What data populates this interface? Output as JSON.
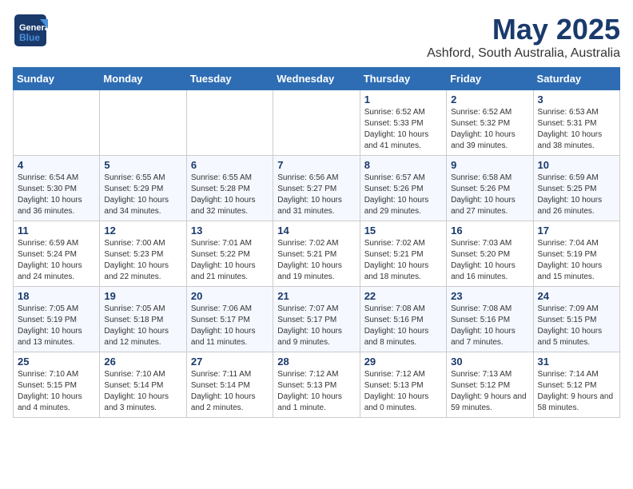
{
  "header": {
    "logo_line1": "General",
    "logo_line2": "Blue",
    "month": "May 2025",
    "location": "Ashford, South Australia, Australia"
  },
  "weekdays": [
    "Sunday",
    "Monday",
    "Tuesday",
    "Wednesday",
    "Thursday",
    "Friday",
    "Saturday"
  ],
  "weeks": [
    [
      {
        "day": "",
        "sunrise": "",
        "sunset": "",
        "daylight": ""
      },
      {
        "day": "",
        "sunrise": "",
        "sunset": "",
        "daylight": ""
      },
      {
        "day": "",
        "sunrise": "",
        "sunset": "",
        "daylight": ""
      },
      {
        "day": "",
        "sunrise": "",
        "sunset": "",
        "daylight": ""
      },
      {
        "day": "1",
        "sunrise": "Sunrise: 6:52 AM",
        "sunset": "Sunset: 5:33 PM",
        "daylight": "Daylight: 10 hours and 41 minutes."
      },
      {
        "day": "2",
        "sunrise": "Sunrise: 6:52 AM",
        "sunset": "Sunset: 5:32 PM",
        "daylight": "Daylight: 10 hours and 39 minutes."
      },
      {
        "day": "3",
        "sunrise": "Sunrise: 6:53 AM",
        "sunset": "Sunset: 5:31 PM",
        "daylight": "Daylight: 10 hours and 38 minutes."
      }
    ],
    [
      {
        "day": "4",
        "sunrise": "Sunrise: 6:54 AM",
        "sunset": "Sunset: 5:30 PM",
        "daylight": "Daylight: 10 hours and 36 minutes."
      },
      {
        "day": "5",
        "sunrise": "Sunrise: 6:55 AM",
        "sunset": "Sunset: 5:29 PM",
        "daylight": "Daylight: 10 hours and 34 minutes."
      },
      {
        "day": "6",
        "sunrise": "Sunrise: 6:55 AM",
        "sunset": "Sunset: 5:28 PM",
        "daylight": "Daylight: 10 hours and 32 minutes."
      },
      {
        "day": "7",
        "sunrise": "Sunrise: 6:56 AM",
        "sunset": "Sunset: 5:27 PM",
        "daylight": "Daylight: 10 hours and 31 minutes."
      },
      {
        "day": "8",
        "sunrise": "Sunrise: 6:57 AM",
        "sunset": "Sunset: 5:26 PM",
        "daylight": "Daylight: 10 hours and 29 minutes."
      },
      {
        "day": "9",
        "sunrise": "Sunrise: 6:58 AM",
        "sunset": "Sunset: 5:26 PM",
        "daylight": "Daylight: 10 hours and 27 minutes."
      },
      {
        "day": "10",
        "sunrise": "Sunrise: 6:59 AM",
        "sunset": "Sunset: 5:25 PM",
        "daylight": "Daylight: 10 hours and 26 minutes."
      }
    ],
    [
      {
        "day": "11",
        "sunrise": "Sunrise: 6:59 AM",
        "sunset": "Sunset: 5:24 PM",
        "daylight": "Daylight: 10 hours and 24 minutes."
      },
      {
        "day": "12",
        "sunrise": "Sunrise: 7:00 AM",
        "sunset": "Sunset: 5:23 PM",
        "daylight": "Daylight: 10 hours and 22 minutes."
      },
      {
        "day": "13",
        "sunrise": "Sunrise: 7:01 AM",
        "sunset": "Sunset: 5:22 PM",
        "daylight": "Daylight: 10 hours and 21 minutes."
      },
      {
        "day": "14",
        "sunrise": "Sunrise: 7:02 AM",
        "sunset": "Sunset: 5:21 PM",
        "daylight": "Daylight: 10 hours and 19 minutes."
      },
      {
        "day": "15",
        "sunrise": "Sunrise: 7:02 AM",
        "sunset": "Sunset: 5:21 PM",
        "daylight": "Daylight: 10 hours and 18 minutes."
      },
      {
        "day": "16",
        "sunrise": "Sunrise: 7:03 AM",
        "sunset": "Sunset: 5:20 PM",
        "daylight": "Daylight: 10 hours and 16 minutes."
      },
      {
        "day": "17",
        "sunrise": "Sunrise: 7:04 AM",
        "sunset": "Sunset: 5:19 PM",
        "daylight": "Daylight: 10 hours and 15 minutes."
      }
    ],
    [
      {
        "day": "18",
        "sunrise": "Sunrise: 7:05 AM",
        "sunset": "Sunset: 5:19 PM",
        "daylight": "Daylight: 10 hours and 13 minutes."
      },
      {
        "day": "19",
        "sunrise": "Sunrise: 7:05 AM",
        "sunset": "Sunset: 5:18 PM",
        "daylight": "Daylight: 10 hours and 12 minutes."
      },
      {
        "day": "20",
        "sunrise": "Sunrise: 7:06 AM",
        "sunset": "Sunset: 5:17 PM",
        "daylight": "Daylight: 10 hours and 11 minutes."
      },
      {
        "day": "21",
        "sunrise": "Sunrise: 7:07 AM",
        "sunset": "Sunset: 5:17 PM",
        "daylight": "Daylight: 10 hours and 9 minutes."
      },
      {
        "day": "22",
        "sunrise": "Sunrise: 7:08 AM",
        "sunset": "Sunset: 5:16 PM",
        "daylight": "Daylight: 10 hours and 8 minutes."
      },
      {
        "day": "23",
        "sunrise": "Sunrise: 7:08 AM",
        "sunset": "Sunset: 5:16 PM",
        "daylight": "Daylight: 10 hours and 7 minutes."
      },
      {
        "day": "24",
        "sunrise": "Sunrise: 7:09 AM",
        "sunset": "Sunset: 5:15 PM",
        "daylight": "Daylight: 10 hours and 5 minutes."
      }
    ],
    [
      {
        "day": "25",
        "sunrise": "Sunrise: 7:10 AM",
        "sunset": "Sunset: 5:15 PM",
        "daylight": "Daylight: 10 hours and 4 minutes."
      },
      {
        "day": "26",
        "sunrise": "Sunrise: 7:10 AM",
        "sunset": "Sunset: 5:14 PM",
        "daylight": "Daylight: 10 hours and 3 minutes."
      },
      {
        "day": "27",
        "sunrise": "Sunrise: 7:11 AM",
        "sunset": "Sunset: 5:14 PM",
        "daylight": "Daylight: 10 hours and 2 minutes."
      },
      {
        "day": "28",
        "sunrise": "Sunrise: 7:12 AM",
        "sunset": "Sunset: 5:13 PM",
        "daylight": "Daylight: 10 hours and 1 minute."
      },
      {
        "day": "29",
        "sunrise": "Sunrise: 7:12 AM",
        "sunset": "Sunset: 5:13 PM",
        "daylight": "Daylight: 10 hours and 0 minutes."
      },
      {
        "day": "30",
        "sunrise": "Sunrise: 7:13 AM",
        "sunset": "Sunset: 5:12 PM",
        "daylight": "Daylight: 9 hours and 59 minutes."
      },
      {
        "day": "31",
        "sunrise": "Sunrise: 7:14 AM",
        "sunset": "Sunset: 5:12 PM",
        "daylight": "Daylight: 9 hours and 58 minutes."
      }
    ]
  ]
}
